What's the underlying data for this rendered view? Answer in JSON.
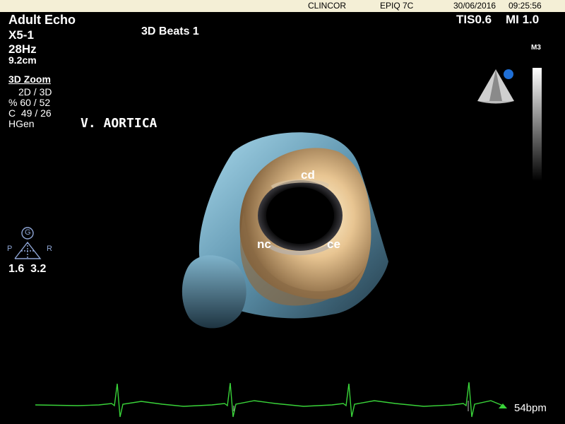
{
  "header": {
    "site": "CLINCOR",
    "system": "EPIQ 7C",
    "date": "30/06/2016",
    "time": "09:25:56"
  },
  "preset": {
    "exam": "Adult Echo",
    "probe": "X5-1",
    "frame_rate": "28Hz",
    "depth": "9.2cm"
  },
  "mode_title": "3D Beats 1",
  "indices": {
    "tis": "TIS0.6",
    "mi": "MI 1.0"
  },
  "scale_label": "M3",
  "zoom_settings": {
    "title": "3D Zoom",
    "lines": [
      "2D / 3D",
      "% 60 / 52",
      "C  49 / 26",
      "HGen"
    ]
  },
  "annotation": {
    "title": "V. AORTICA",
    "cusps": {
      "right_coronary": "cd",
      "non_coronary": "nc",
      "left_coronary": "ce"
    }
  },
  "orientation": {
    "marker": "G",
    "left": "P",
    "right": "R",
    "values": "1.6  3.2"
  },
  "ecg": {
    "heart_rate": "54bpm",
    "trace_color": "#39d339"
  },
  "icons": [
    "probe-orientation-icon",
    "grayscale-bar",
    "orientation-cube-icon",
    "ecg-trace"
  ]
}
